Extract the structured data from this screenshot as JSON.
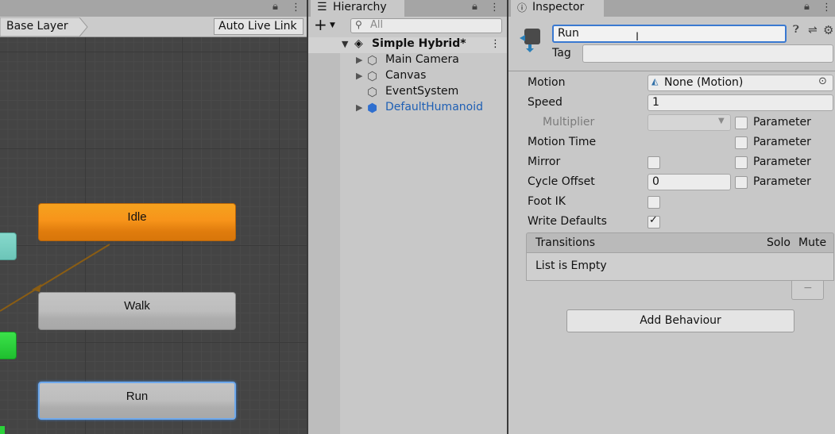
{
  "animator": {
    "breadcrumb": "Base Layer",
    "auto_live_link": "Auto Live Link",
    "states": {
      "idle": "Idle",
      "walk": "Walk",
      "run": "Run"
    },
    "colors": {
      "default_state": "#f7941a",
      "selected_outline": "#6fa9ec",
      "entry_node": "#2ecc40",
      "any_state": "#7ad1c4"
    }
  },
  "hierarchy": {
    "tab_label": "Hierarchy",
    "search_placeholder": "All",
    "add_label": "+",
    "scene": "Simple Hybrid*",
    "items": [
      {
        "label": "Main Camera",
        "expandable": true
      },
      {
        "label": "Canvas",
        "expandable": true
      },
      {
        "label": "EventSystem",
        "expandable": false
      },
      {
        "label": "DefaultHumanoid",
        "expandable": true,
        "color": "#1e5fb4"
      }
    ]
  },
  "inspector": {
    "tab_label": "Inspector",
    "name_value": "Run",
    "tag_label": "Tag",
    "tag_value": "",
    "rows": {
      "motion": {
        "label": "Motion",
        "value": "None (Motion)"
      },
      "speed": {
        "label": "Speed",
        "value": "1"
      },
      "multiplier": {
        "label": "Multiplier",
        "param": "Parameter"
      },
      "motion_time": {
        "label": "Motion Time",
        "param": "Parameter"
      },
      "mirror": {
        "label": "Mirror",
        "param": "Parameter"
      },
      "cycle_offset": {
        "label": "Cycle Offset",
        "value": "0",
        "param": "Parameter"
      },
      "foot_ik": {
        "label": "Foot IK"
      },
      "write_defaults": {
        "label": "Write Defaults",
        "checked": true
      }
    },
    "transitions": {
      "header": "Transitions",
      "solo": "Solo",
      "mute": "Mute",
      "empty": "List is Empty",
      "remove": "−"
    },
    "add_behaviour": "Add Behaviour"
  }
}
